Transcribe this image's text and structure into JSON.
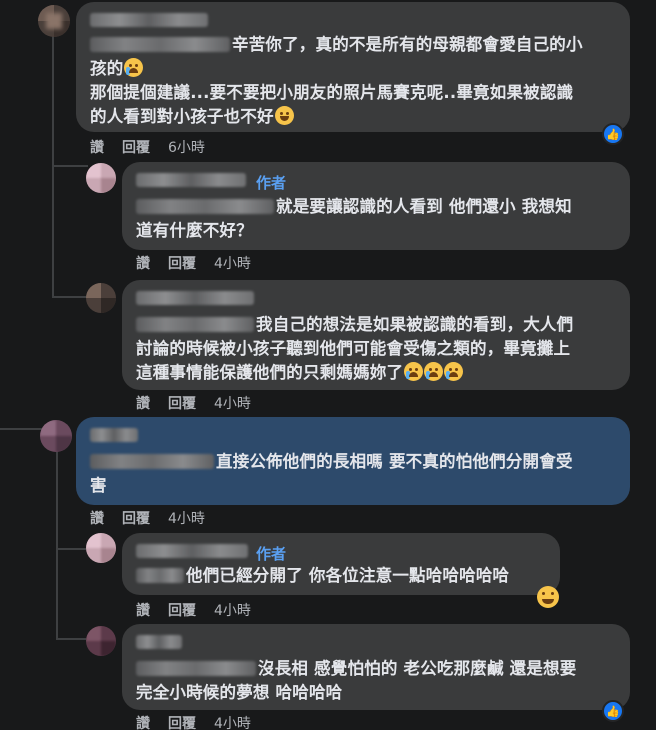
{
  "labels": {
    "like": "讚",
    "reply": "回覆",
    "author": "作者"
  },
  "comments": [
    {
      "line1": "辛苦你了，真的不是所有的母親都會愛自己的小",
      "line2": "孩的",
      "line3": "那個提個建議...要不要把小朋友的照片馬賽克呢..畢竟如果被認識",
      "line4": "的人看到對小孩子也不好",
      "time": "6小時"
    },
    {
      "line1": "就是要讓認識的人看到 他們還小 我想知",
      "line2": "道有什麼不好？",
      "time": "4小時"
    },
    {
      "line1": "我自己的想法是如果被認識的看到，大人們",
      "line2": "討論的時候被小孩子聽到他們可能會受傷之類的，畢竟攤上",
      "line3": "這種事情能保護他們的只剩媽媽妳了",
      "time": "4小時"
    },
    {
      "line1": "直接公佈他們的長相嗎 要不真的怕他們分開會受",
      "line2": "害",
      "time": "4小時"
    },
    {
      "line1": "他們已經分開了 你各位注意一點哈哈哈哈哈",
      "time": "4小時"
    },
    {
      "line1": "沒長相 感覺怕怕的 老公吃那麼鹹 還是想要",
      "line2": "完全小時候的夢想 哈哈哈哈",
      "time": "4小時"
    }
  ],
  "icons": {
    "reaction": "thumbs-up-icon",
    "crying": "crying-face-emoji",
    "laughing": "laughing-face-emoji"
  },
  "colors": {
    "background": "#18191a",
    "bubble": "#3a3b3c",
    "highlight": "#2d4a6b",
    "accent": "#1877f2"
  }
}
